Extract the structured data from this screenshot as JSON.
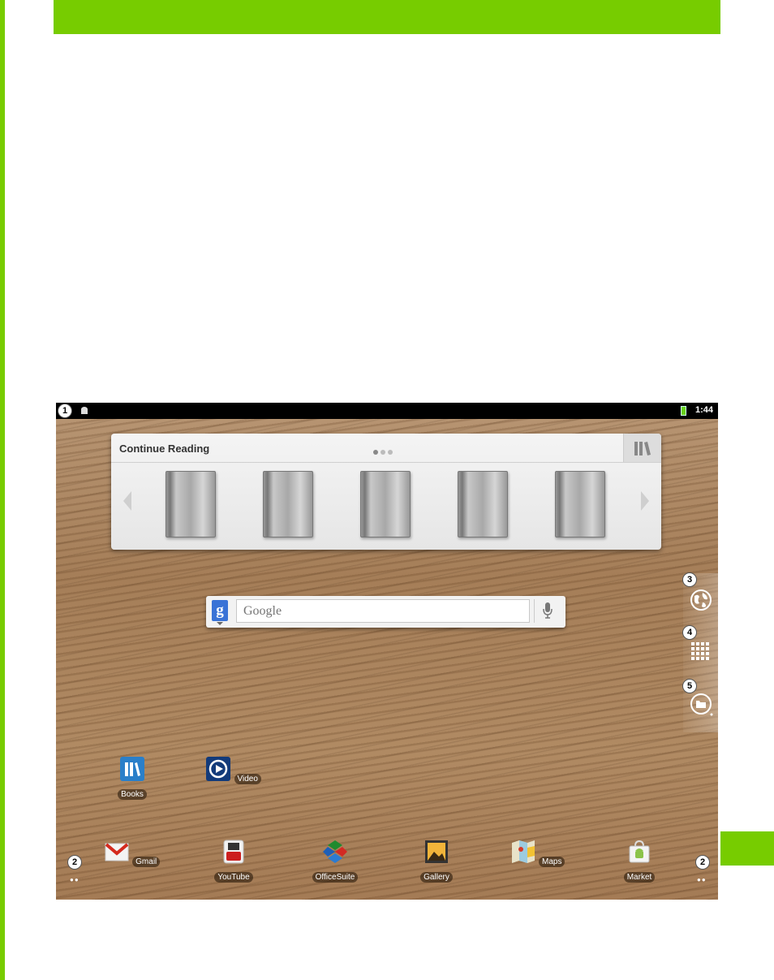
{
  "status_bar": {
    "badge": "1",
    "time": "1:44"
  },
  "reading_widget": {
    "title": "Continue Reading",
    "page_count": 3,
    "active_page": 1,
    "books_shown": 5
  },
  "search": {
    "placeholder": "Google",
    "logo_letter": "g"
  },
  "right_dock": {
    "badges": [
      "3",
      "4",
      "5"
    ],
    "icons": [
      "browser-globe-icon",
      "all-apps-grid-icon",
      "file-manager-icon"
    ]
  },
  "apps": [
    {
      "label": "Books",
      "icon": "books-icon"
    },
    {
      "label": "Video",
      "icon": "video-icon"
    }
  ],
  "dock_apps": [
    {
      "label": "Gmail",
      "icon": "gmail-icon"
    },
    {
      "label": "YouTube",
      "icon": "youtube-icon"
    },
    {
      "label": "OfficeSuite",
      "icon": "officesuite-icon"
    },
    {
      "label": "Gallery",
      "icon": "gallery-icon"
    },
    {
      "label": "Maps",
      "icon": "maps-icon"
    },
    {
      "label": "Market",
      "icon": "market-icon"
    }
  ],
  "page_badges": {
    "left": "2",
    "right": "2"
  },
  "colors": {
    "accent_green": "#77cc00",
    "status_bar": "#000000"
  }
}
